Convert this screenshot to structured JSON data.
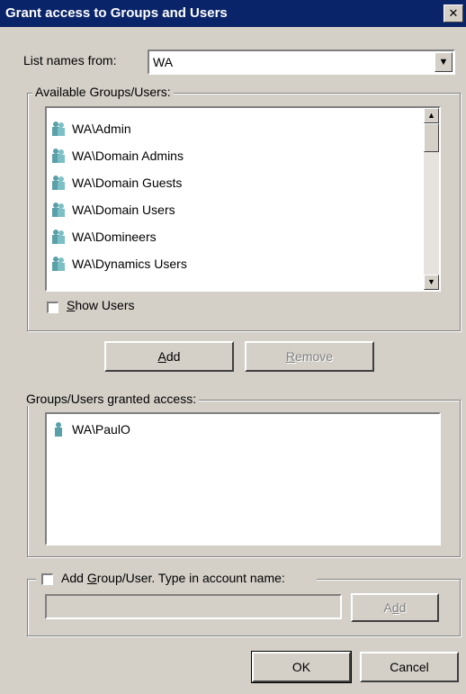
{
  "dialog": {
    "title": "Grant access to Groups and Users",
    "close_glyph": "✕"
  },
  "list_names_from": {
    "label": "List names from:",
    "value": "WA",
    "dropdown_glyph": "▼"
  },
  "available": {
    "legend": "Available Groups/Users:",
    "items": [
      {
        "label": "WA\\Admin",
        "icon": "group-icon"
      },
      {
        "label": "WA\\Domain Admins",
        "icon": "group-icon"
      },
      {
        "label": "WA\\Domain Guests",
        "icon": "group-icon"
      },
      {
        "label": "WA\\Domain Users",
        "icon": "group-icon"
      },
      {
        "label": "WA\\Domineers",
        "icon": "group-icon"
      },
      {
        "label": "WA\\Dynamics Users",
        "icon": "group-icon"
      }
    ],
    "show_users": {
      "label_pre": "",
      "label_accel": "S",
      "label_post": "how Users",
      "checked": false
    }
  },
  "buttons": {
    "add": {
      "accel": "A",
      "rest": "dd"
    },
    "remove": {
      "accel": "R",
      "rest": "emove",
      "disabled": true
    }
  },
  "granted": {
    "legend": "Groups/Users granted access:",
    "items": [
      {
        "label": "WA\\PaulO",
        "icon": "user-icon"
      }
    ]
  },
  "add_account": {
    "label_pre": "Add ",
    "label_accel": "G",
    "label_post": "roup/User. Type in account name:",
    "checked": false,
    "input_value": "",
    "add_button": {
      "pre": "A",
      "accel": "d",
      "post": "d",
      "disabled": true
    }
  },
  "footer": {
    "ok_label": "OK",
    "cancel_label": "Cancel"
  },
  "colors": {
    "title_bar": "#0a246a",
    "face": "#d4d0c8",
    "group_icon": "#5aa0a8"
  },
  "scrollbar": {
    "up_glyph": "▲",
    "down_glyph": "▼"
  }
}
